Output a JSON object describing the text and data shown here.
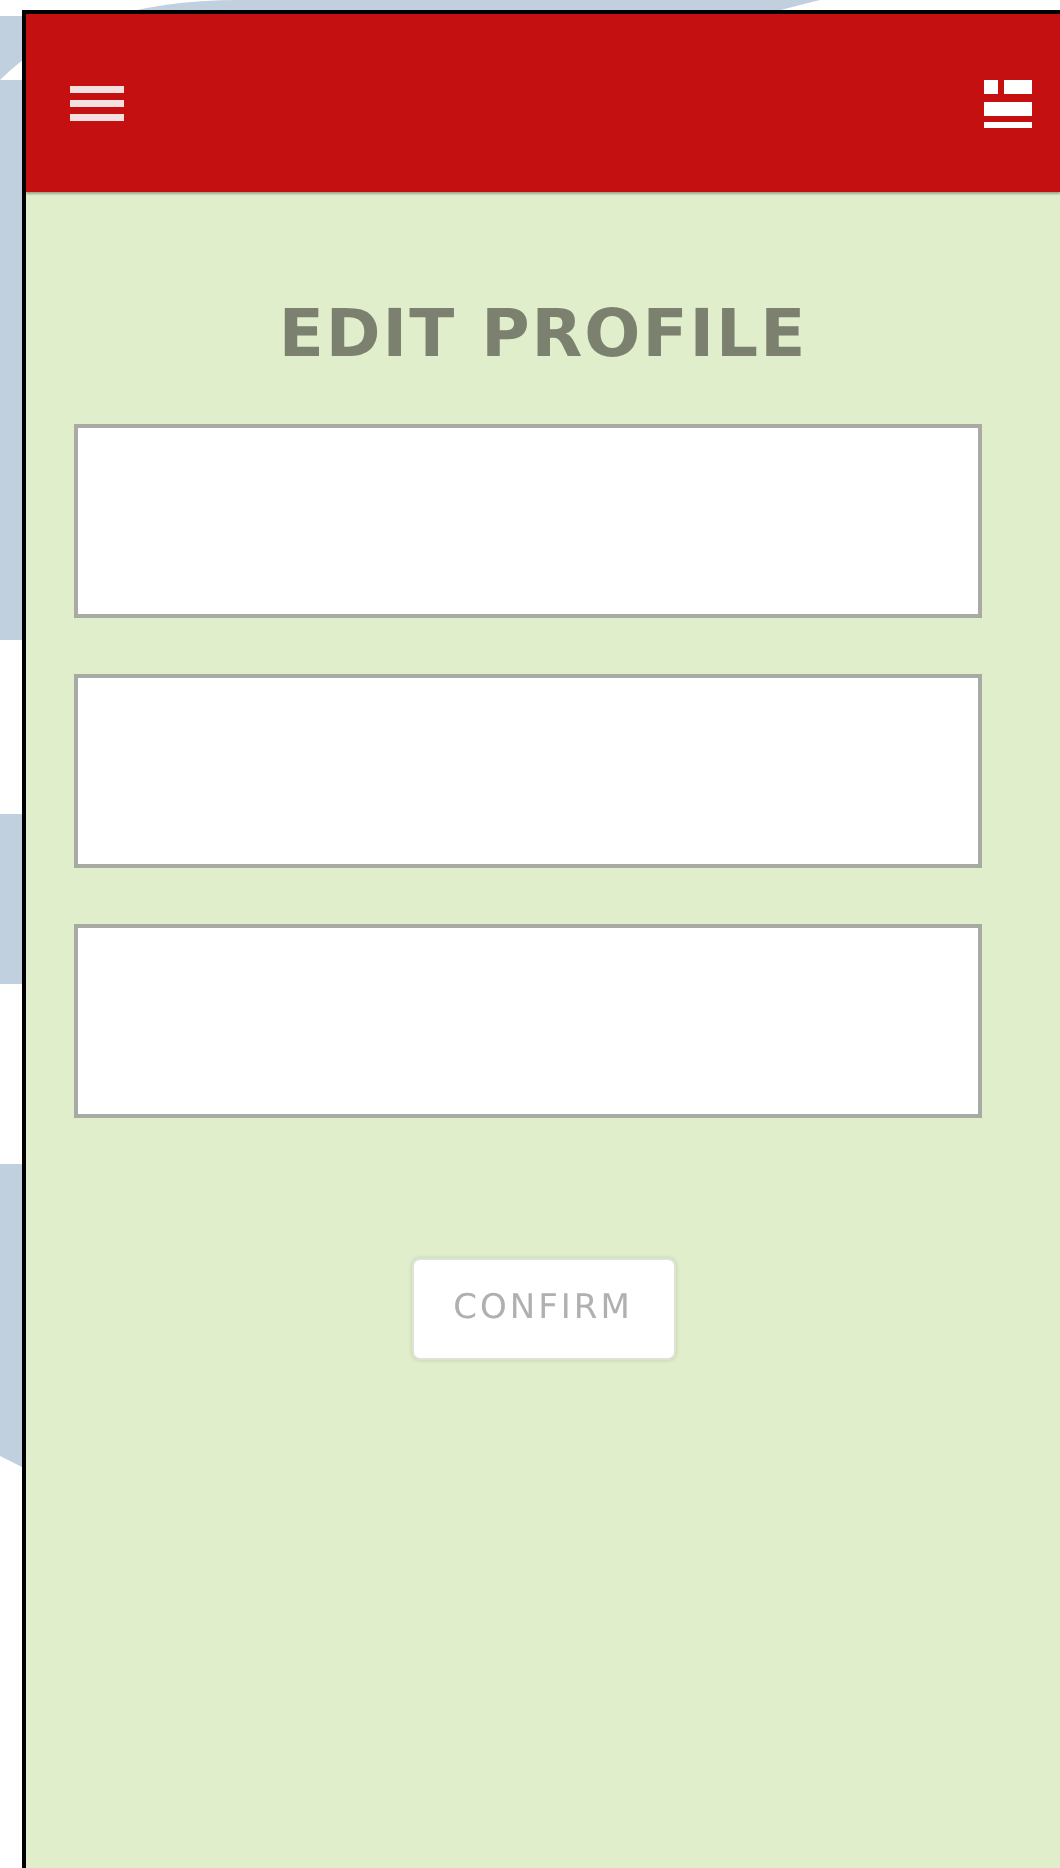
{
  "title": "EDIT PROFILE",
  "fields": [
    {
      "kind": "text"
    },
    {
      "kind": "text"
    },
    {
      "kind": "text"
    }
  ],
  "confirm_button": "CONFIRM"
}
